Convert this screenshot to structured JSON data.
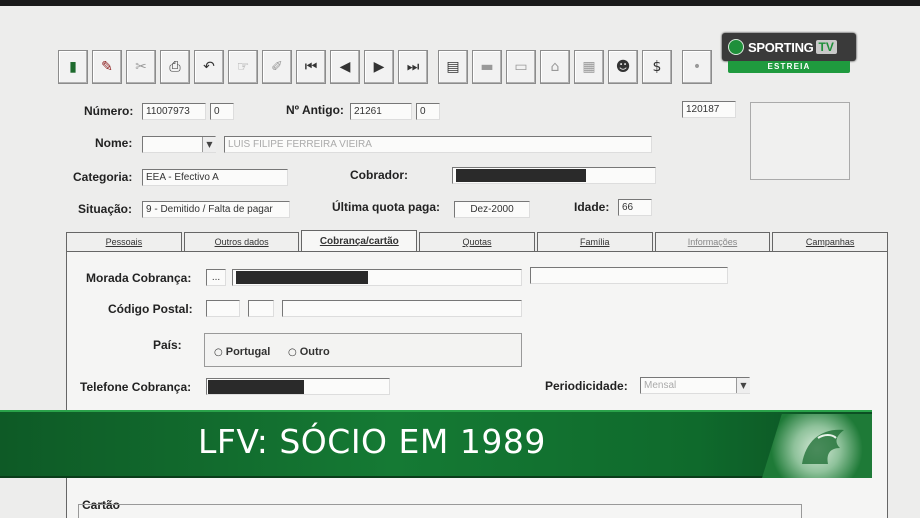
{
  "form": {
    "numero_label": "Número:",
    "numero_value": "11007973",
    "numero_suffix": "0",
    "antigo_label": "Nº Antigo:",
    "antigo_value": "21261",
    "antigo_suffix": "0",
    "code_value": "120187",
    "nome_label": "Nome:",
    "nome_value": "LUIS FILIPE FERREIRA VIEIRA",
    "categoria_label": "Categoria:",
    "categoria_value": "EEA - Efectivo A",
    "cobrador_label": "Cobrador:",
    "situacao_label": "Situação:",
    "situacao_value": "9 - Demitido / Falta de pagar",
    "ultima_quota_label": "Última quota paga:",
    "ultima_quota_value": "Dez-2000",
    "idade_label": "Idade:",
    "idade_value": "66"
  },
  "tabs": [
    {
      "label": "Pessoais"
    },
    {
      "label": "Outros dados"
    },
    {
      "label": "Cobrança/cartão"
    },
    {
      "label": "Quotas"
    },
    {
      "label": "Família"
    },
    {
      "label": "Informações"
    },
    {
      "label": "Campanhas"
    }
  ],
  "panel": {
    "morada_label": "Morada Cobrança:",
    "morada_btn": "...",
    "codigo_postal_label": "Código Postal:",
    "pais_label": "País:",
    "pais_opt1": "Portugal",
    "pais_opt2": "Outro",
    "telefone_label": "Telefone Cobrança:",
    "periodicidade_label": "Periodicidade:",
    "periodicidade_value": "Mensal",
    "cartao_label": "Cartão"
  },
  "toolbar": {
    "undo": "↶",
    "first": "⏮",
    "prev": "◀",
    "next": "▶",
    "last": "⏭",
    "dollar": "$"
  },
  "logo": {
    "name": "SPORTING",
    "tv": "TV",
    "tagline": "ESTREIA"
  },
  "banner": {
    "text": "LFV: SÓCIO EM 1989"
  },
  "colors": {
    "banner_green": "#157a34",
    "logo_green": "#1f9a3e"
  }
}
